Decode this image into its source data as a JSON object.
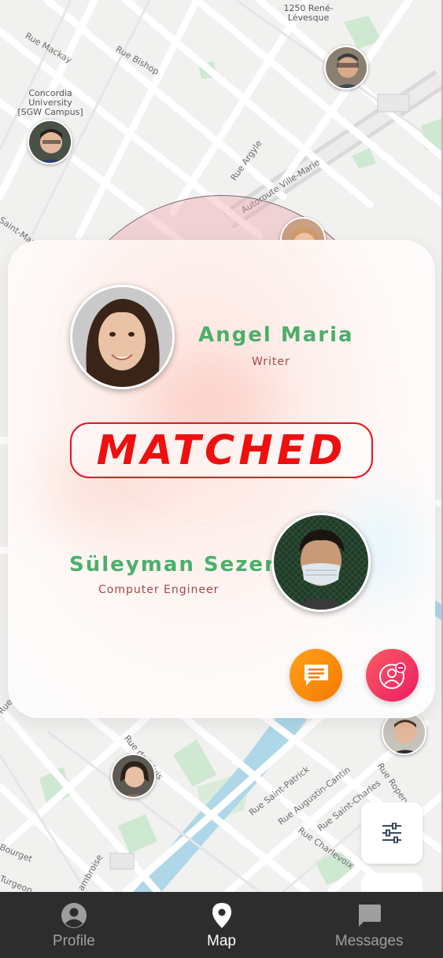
{
  "map": {
    "poi": {
      "concordia": "Concordia University\n[SGW Campus]",
      "rene_levesque": "1250 René-\nLévesque"
    },
    "streets": [
      "Rue Mackay",
      "Rue Bishop",
      "Rue Argyle",
      "Autoroute Ville-Marie",
      "Saint-Marc",
      "Rue de Lévis",
      "Rue Saint-Patrick",
      "Rue Augustin-Cantin",
      "Rue Saint-Charles",
      "Rue Ropery",
      "Rue Charlevoix",
      "Bourget",
      "Turgeon",
      "ambroise",
      "Rue Deli"
    ]
  },
  "match": {
    "status": "MATCHED",
    "person_a": {
      "name": "Angel Maria",
      "role": "Writer"
    },
    "person_b": {
      "name": "Süleyman Sezer",
      "role": "Computer Engineer"
    }
  },
  "colors": {
    "name_green": "#4caf6a",
    "role_red": "#a3484a",
    "matched_red": "#ee0f0f",
    "chat_orange": "#f57a00",
    "unmatch_pink": "#ee1c64",
    "nav_bg": "#2d2d2d"
  },
  "icons": {
    "chat": "chat-bubble-icon",
    "unmatch": "user-remove-icon",
    "filter": "sliders-icon",
    "profile": "account-circle-icon",
    "map": "location-pin-icon",
    "messages": "message-icon"
  },
  "bottom_nav": {
    "items": [
      {
        "label": "Profile",
        "active": false
      },
      {
        "label": "Map",
        "active": true
      },
      {
        "label": "Messages",
        "active": false
      }
    ]
  }
}
